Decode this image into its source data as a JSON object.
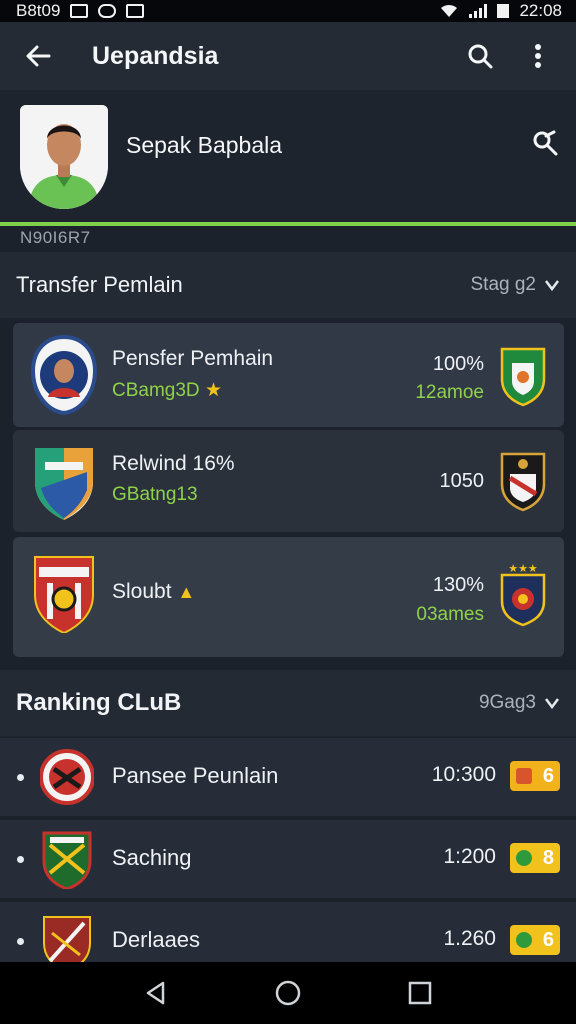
{
  "status_bar": {
    "left_text": "B8t09",
    "time": "22:08"
  },
  "app_bar": {
    "title": "Uepandsia",
    "icons": [
      "back-arrow-icon",
      "search-icon",
      "more-vert-icon"
    ]
  },
  "profile": {
    "name": "Sepak Bapbala",
    "code": "N90I6R7"
  },
  "transfer_section": {
    "title": "Transfer Pemlain",
    "filter_label": "Stag g2",
    "cards": [
      {
        "title": "Pensfer Pemhain",
        "subtitle": "CBamg3D",
        "value": "100%",
        "value2": "12amoe"
      },
      {
        "title": "Relwind 16%",
        "subtitle": "GBatng13",
        "value": "1050",
        "value2": ""
      },
      {
        "title": "Sloubt",
        "subtitle": "",
        "value": "130%",
        "value2": "03ames"
      }
    ]
  },
  "ranking_section": {
    "title": "Ranking CLuB",
    "filter_label": "9Gag3",
    "rows": [
      {
        "name": "Pansee Peunlain",
        "value": "10:300",
        "badge": "6"
      },
      {
        "name": "Saching",
        "value": "1:200",
        "badge": "8"
      },
      {
        "name": "Derlaaes",
        "value": "1.260",
        "badge": "6"
      }
    ]
  },
  "colors": {
    "accent_green": "#8fd24a",
    "badge_yellow": "#f2c21c",
    "background": "#1c222b"
  }
}
